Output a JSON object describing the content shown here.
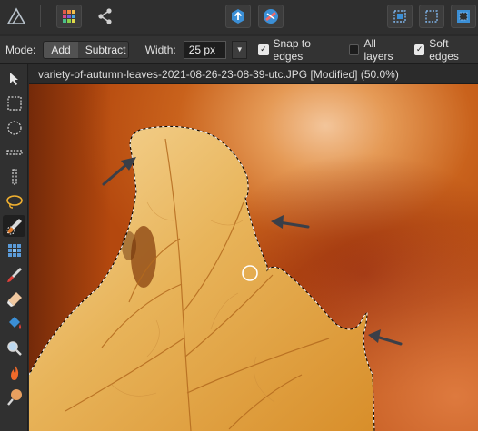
{
  "toolbar": {
    "icons": [
      "affinity-logo-icon",
      "photo-persona-icon",
      "share-icon",
      "upload-cloud-icon",
      "heal-icon",
      "select-all-icon",
      "deselect-icon",
      "invert-selection-icon"
    ]
  },
  "context": {
    "mode_label": "Mode:",
    "mode_add": "Add",
    "mode_subtract": "Subtract",
    "width_label": "Width:",
    "width_value": "25 px",
    "snap_label": "Snap to edges",
    "snap_checked": true,
    "all_layers_label": "All layers",
    "all_layers_checked": false,
    "soft_edges_label": "Soft edges",
    "soft_edges_checked": true
  },
  "document": {
    "title": "variety-of-autumn-leaves-2021-08-26-23-08-39-utc.JPG [Modified] (50.0%)"
  },
  "tools": [
    "move-tool-icon",
    "rect-marquee-icon",
    "ellipse-marquee-icon",
    "row-marquee-icon",
    "column-marquee-icon",
    "freehand-selection-icon",
    "selection-brush-icon",
    "flood-select-icon",
    "paint-brush-icon",
    "erase-brush-icon",
    "flood-fill-icon",
    "zoom-icon",
    "burn-icon",
    "dodge-icon"
  ],
  "colors": {
    "accent": "#2f8fd8",
    "leaf": "#e8b45a",
    "background_orange": "#c9621c"
  }
}
